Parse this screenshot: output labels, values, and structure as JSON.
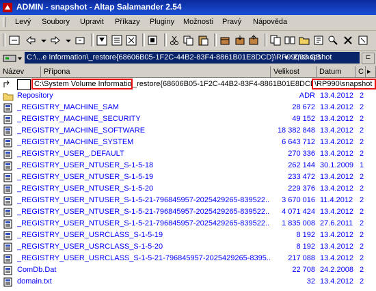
{
  "window": {
    "title": "ADMIN - snapshot - Altap Salamander 2.54"
  },
  "menu": {
    "items": [
      "Levý",
      "Soubory",
      "Upravit",
      "Příkazy",
      "Pluginy",
      "Možnosti",
      "Pravý",
      "Nápověda"
    ]
  },
  "pathbar": {
    "path": "C:\\...e Information\\_restore{68606B05-1F2C-44B2-83F4-8861B01E8DCD}\\RP990\\snapshot",
    "arrow": "▾",
    "free_space": "2,93 GB",
    "button": "⊏"
  },
  "columns": {
    "name": "Název",
    "ext": "Přípona",
    "size": "Velikost",
    "date": "Datum",
    "extra": "C"
  },
  "current_path": {
    "part1": "C:\\System Volume Information\\",
    "part2": "_restore{68606B05-1F2C-44B2-83F4-8861B01E8DCD}",
    "part3": "\\RP990\\snapshot"
  },
  "files": [
    {
      "name": "Repository",
      "size": "ADR",
      "date": "13.4.2012",
      "extra": "2",
      "type": "folder"
    },
    {
      "name": "_REGISTRY_MACHINE_SAM",
      "size": "28 672",
      "date": "13.4.2012",
      "extra": "2",
      "type": "file"
    },
    {
      "name": "_REGISTRY_MACHINE_SECURITY",
      "size": "49 152",
      "date": "13.4.2012",
      "extra": "2",
      "type": "file"
    },
    {
      "name": "_REGISTRY_MACHINE_SOFTWARE",
      "size": "18 382 848",
      "date": "13.4.2012",
      "extra": "2",
      "type": "file"
    },
    {
      "name": "_REGISTRY_MACHINE_SYSTEM",
      "size": "6 643 712",
      "date": "13.4.2012",
      "extra": "2",
      "type": "file"
    },
    {
      "name": "_REGISTRY_USER_.DEFAULT",
      "size": "270 336",
      "date": "13.4.2012",
      "extra": "2",
      "type": "file"
    },
    {
      "name": "_REGISTRY_USER_NTUSER_S-1-5-18",
      "size": "262 144",
      "date": "30.1.2009",
      "extra": "1",
      "type": "file"
    },
    {
      "name": "_REGISTRY_USER_NTUSER_S-1-5-19",
      "size": "233 472",
      "date": "13.4.2012",
      "extra": "2",
      "type": "file"
    },
    {
      "name": "_REGISTRY_USER_NTUSER_S-1-5-20",
      "size": "229 376",
      "date": "13.4.2012",
      "extra": "2",
      "type": "file"
    },
    {
      "name": "_REGISTRY_USER_NTUSER_S-1-5-21-796845957-2025429265-839522...",
      "size": "3 670 016",
      "date": "11.4.2012",
      "extra": "2",
      "type": "file"
    },
    {
      "name": "_REGISTRY_USER_NTUSER_S-1-5-21-796845957-2025429265-839522...",
      "size": "4 071 424",
      "date": "13.4.2012",
      "extra": "2",
      "type": "file"
    },
    {
      "name": "_REGISTRY_USER_NTUSER_S-1-5-21-796845957-2025429265-839522...",
      "size": "1 835 008",
      "date": "27.6.2011",
      "extra": "2",
      "type": "file"
    },
    {
      "name": "_REGISTRY_USER_USRCLASS_S-1-5-19",
      "size": "8 192",
      "date": "13.4.2012",
      "extra": "2",
      "type": "file"
    },
    {
      "name": "_REGISTRY_USER_USRCLASS_S-1-5-20",
      "size": "8 192",
      "date": "13.4.2012",
      "extra": "2",
      "type": "file"
    },
    {
      "name": "_REGISTRY_USER_USRCLASS_S-1-5-21-796845957-2025429265-8395...",
      "size": "217 088",
      "date": "13.4.2012",
      "extra": "2",
      "type": "file"
    },
    {
      "name": "ComDb.Dat",
      "size": "22 708",
      "date": "24.2.2008",
      "extra": "2",
      "type": "file"
    },
    {
      "name": "domain.txt",
      "size": "32",
      "date": "13.4.2012",
      "extra": "2",
      "type": "file"
    }
  ]
}
